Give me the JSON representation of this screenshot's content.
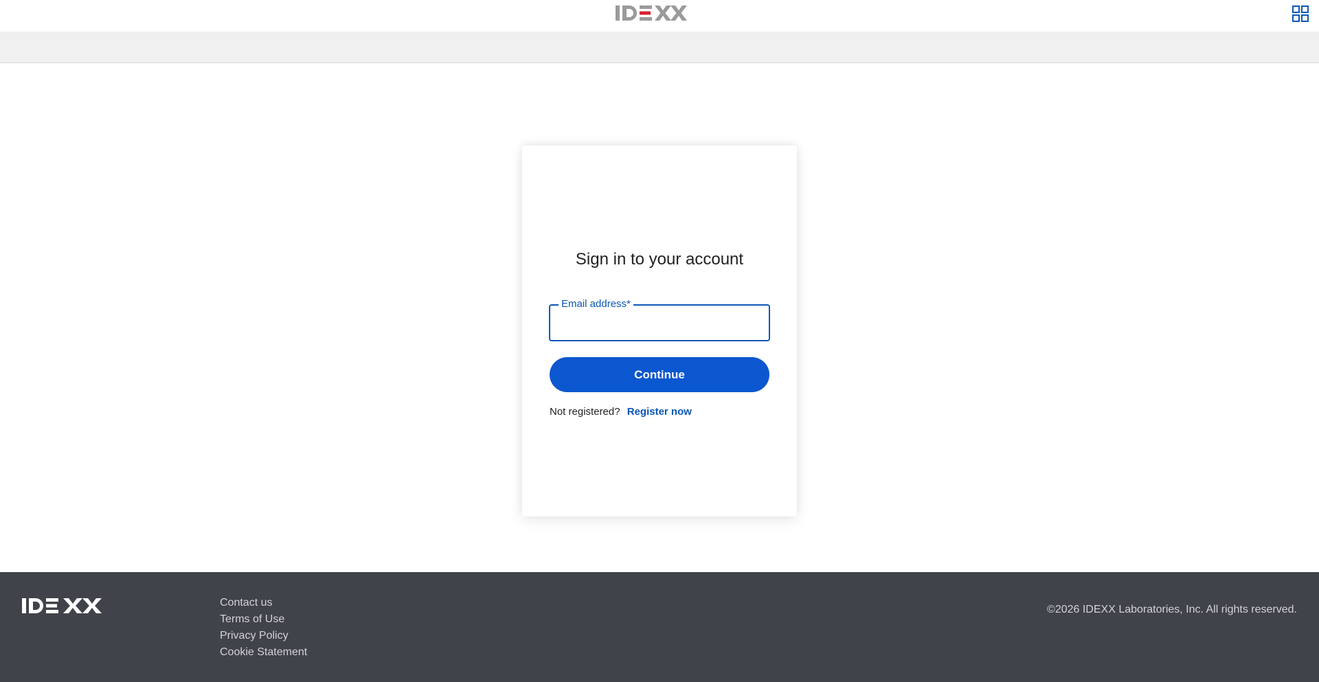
{
  "header": {
    "logo_text": "IDEXX",
    "apps_icon": "apps-grid-icon"
  },
  "signin": {
    "title": "Sign in to your account",
    "email_label": "Email address*",
    "email_value": "",
    "continue_label": "Continue",
    "not_registered_text": "Not registered?",
    "register_label": "Register now"
  },
  "footer": {
    "logo_text": "IDEXX",
    "links": [
      "Contact us",
      "Terms of Use",
      "Privacy Policy",
      "Cookie Statement"
    ],
    "copyright": "©2026 IDEXX Laboratories, Inc. All rights reserved."
  },
  "colors": {
    "accent": "#0b57d0",
    "footer_bg": "#40434a",
    "logo_red": "#d6232d"
  }
}
